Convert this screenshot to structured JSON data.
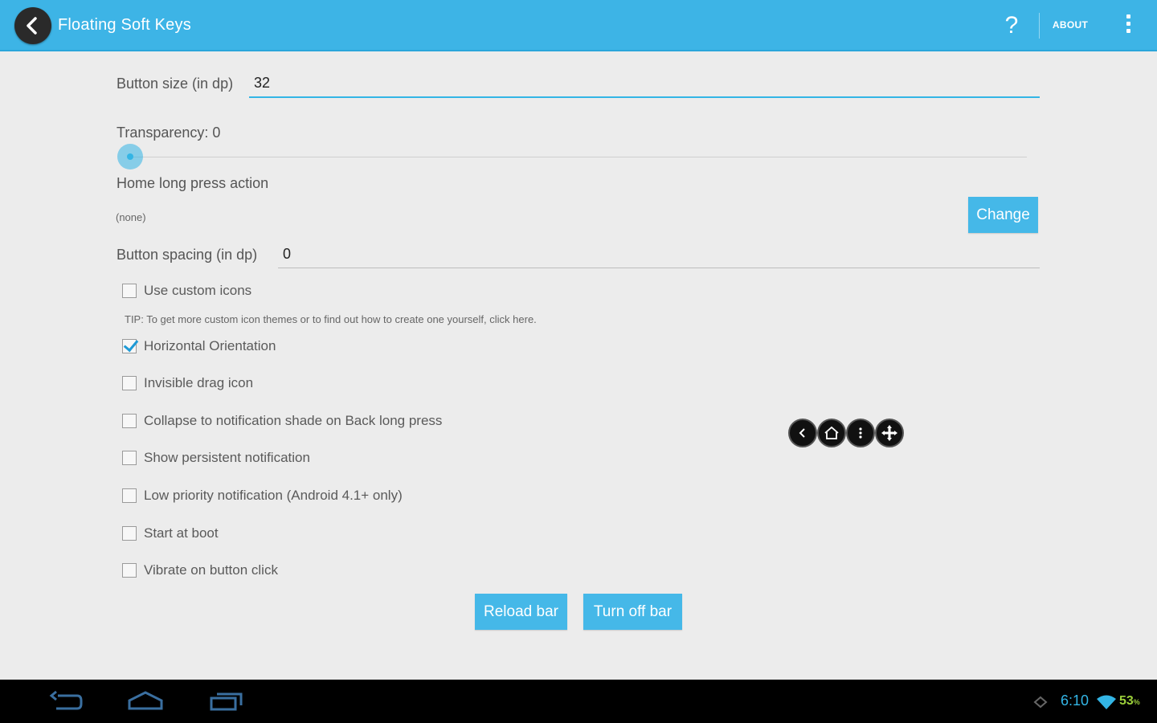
{
  "actionbar": {
    "title": "Floating Soft Keys",
    "help_glyph": "?",
    "about_label": "ABOUT",
    "color": "#3db4e6"
  },
  "settings": {
    "button_size_label": "Button size (in dp)",
    "button_size_value": "32",
    "transparency_label": "Transparency: 0",
    "transparency_value": 0,
    "home_long_press_label": "Home long press action",
    "home_long_press_value": "(none)",
    "change_button": "Change",
    "button_spacing_label": "Button spacing (in dp)",
    "button_spacing_value": "0",
    "tip_text": "TIP: To get more custom icon themes or to find out how to create one yourself, click here."
  },
  "checkboxes": [
    {
      "label": "Use custom icons",
      "checked": false
    },
    {
      "label": "Horizontal Orientation",
      "checked": true
    },
    {
      "label": "Invisible drag icon",
      "checked": false
    },
    {
      "label": "Collapse to notification shade on Back long press",
      "checked": false
    },
    {
      "label": "Show persistent notification",
      "checked": false
    },
    {
      "label": "Low priority notification (Android 4.1+ only)",
      "checked": false
    },
    {
      "label": "Start at boot",
      "checked": false
    },
    {
      "label": "Vibrate on button click",
      "checked": false
    }
  ],
  "actions": {
    "reload": "Reload bar",
    "turn_off": "Turn off bar"
  },
  "floating_bar": {
    "icons": [
      "back-icon",
      "home-icon",
      "menu-icon",
      "move-icon"
    ]
  },
  "system_bar": {
    "time": "6:10",
    "battery": "53",
    "accent": "#33b5e5",
    "battery_color": "#9cd13a"
  }
}
